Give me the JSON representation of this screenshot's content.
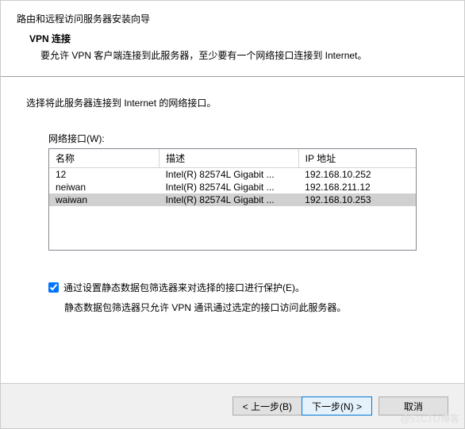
{
  "header": {
    "wizard_title": "路由和远程访问服务器安装向导",
    "section_title": "VPN 连接",
    "section_desc": "要允许 VPN 客户端连接到此服务器，至少要有一个网络接口连接到 Internet。"
  },
  "content": {
    "instruction": "选择将此服务器连接到 Internet 的网络接口。",
    "table_label": "网络接口(W):",
    "columns": {
      "name": "名称",
      "desc": "描述",
      "ip": "IP 地址"
    },
    "rows": [
      {
        "name": "12",
        "desc": "Intel(R) 82574L Gigabit ...",
        "ip": "192.168.10.252"
      },
      {
        "name": "neiwan",
        "desc": "Intel(R) 82574L Gigabit ...",
        "ip": "192.168.211.12"
      },
      {
        "name": "waiwan",
        "desc": "Intel(R) 82574L Gigabit ...",
        "ip": "192.168.10.253"
      }
    ],
    "checkbox_label": "通过设置静态数据包筛选器来对选择的接口进行保护(E)。",
    "checkbox_desc": "静态数据包筛选器只允许 VPN 通讯通过选定的接口访问此服务器。"
  },
  "footer": {
    "back": "< 上一步(B)",
    "next": "下一步(N) >",
    "cancel": "取消"
  },
  "watermark": "@51CTO博客"
}
